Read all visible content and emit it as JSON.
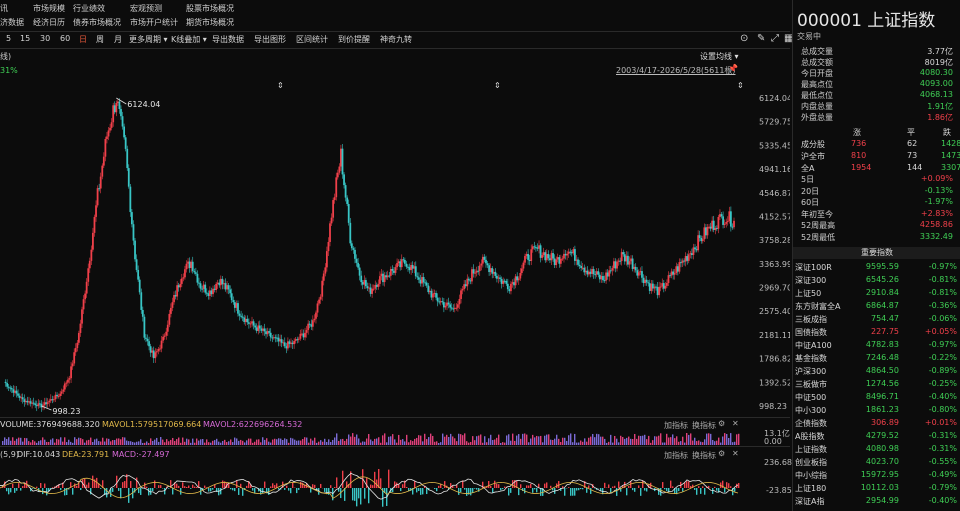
{
  "menu": {
    "row1": [
      "讯",
      "市场规模",
      "行业绩效",
      "宏观预测",
      "股票市场概况"
    ],
    "row2": [
      "济数据",
      "经济日历",
      "债券市场概况",
      "市场开户统计",
      "期货市场概况"
    ]
  },
  "toolbar": {
    "items": [
      "5",
      "15",
      "30",
      "60",
      "日",
      "周",
      "月",
      "更多周期 ▾",
      "K线叠加 ▾",
      "导出数据",
      "导出图形",
      "区间统计",
      "到价提醒",
      "神奇九转"
    ],
    "active": "日",
    "right_icons": [
      "circle-chevron",
      "pen",
      "expand",
      "grid"
    ]
  },
  "chart_header": {
    "left_label": "线)",
    "percent": "31%",
    "settings": "设置均线 ▾",
    "range": "2003/4/17-2026/5/28(5611根)"
  },
  "chart_data": {
    "type": "line",
    "title": "",
    "ylabels": [
      "6124.04",
      "5729.75",
      "5335.45",
      "4941.16",
      "4546.87",
      "4152.57",
      "3758.28",
      "3363.99",
      "2969.70",
      "2575.40",
      "2181.11",
      "1786.82",
      "1392.52",
      "998.23"
    ],
    "ylim": [
      998.23,
      6124.04
    ],
    "x_start": "2003/4/17",
    "x_end": "2026/5/28",
    "annotations": [
      {
        "label": "6124.04"
      },
      {
        "label": "998.23"
      }
    ],
    "series": [
      {
        "values": [
          1400,
          1250,
          1100,
          1050,
          998,
          1100,
          1200,
          1500,
          2200,
          3300,
          4500,
          5500,
          6124,
          5200,
          3500,
          2200,
          1800,
          2100,
          2700,
          3200,
          3400,
          3000,
          2900,
          3100,
          2900,
          2600,
          2400,
          2300,
          2200,
          2100,
          2000,
          2050,
          2200,
          2400,
          3000,
          4200,
          5178,
          3800,
          3200,
          2900,
          3100,
          3200,
          3300,
          3400,
          3200,
          3000,
          2800,
          2700,
          2600,
          2900,
          3200,
          3400,
          3300,
          3100,
          3000,
          3200,
          3500,
          3600,
          3500,
          3400,
          3600,
          3500,
          3300,
          3200,
          3100,
          3300,
          3500,
          3400,
          3200,
          3000,
          2900,
          3100,
          3300,
          3500,
          3700,
          3900,
          4050,
          4150,
          4080
        ]
      }
    ]
  },
  "volume": {
    "label": "VOLUME:376949688.320",
    "mavol1": "MAVOL1:579517069.664",
    "mavol2": "MAVOL2:622696264.532",
    "tick_top": "13.1亿",
    "tick_bottom": "0.00",
    "add_indicator": "加指标",
    "switch_indicator": "换指标"
  },
  "macd": {
    "params": "(5,9)",
    "dif": "DIF:10.043",
    "dea": "DEA:23.791",
    "macd": "MACD:-27.497",
    "tick_top": "236.68",
    "tick_mid": "-23.85",
    "add_indicator": "加指标",
    "switch_indicator": "换指标"
  },
  "stock": {
    "code_name": "000001 上证指数",
    "status": "交易中",
    "stats": [
      {
        "k": "总成交量",
        "v": "3.77亿",
        "c": "white"
      },
      {
        "k": "总成交额",
        "v": "8019亿",
        "c": "white"
      },
      {
        "k": "今日开盘",
        "v": "4080.30",
        "c": "green"
      },
      {
        "k": "最高点位",
        "v": "4093.00",
        "c": "green"
      },
      {
        "k": "最低点位",
        "v": "4068.13",
        "c": "green"
      },
      {
        "k": "内盘总量",
        "v": "1.91亿",
        "c": "green"
      },
      {
        "k": "外盘总量",
        "v": "1.86亿",
        "c": "red"
      }
    ],
    "breadth_header": [
      "涨",
      "平",
      "跌"
    ],
    "breadth": [
      {
        "k": "成分股",
        "up": "736",
        "flat": "62",
        "down": "1428"
      },
      {
        "k": "沪全市",
        "up": "810",
        "flat": "73",
        "down": "1473"
      },
      {
        "k": "全A",
        "up": "1954",
        "flat": "144",
        "down": "3307"
      }
    ],
    "periods": [
      {
        "k": "5日",
        "v": "+0.09%",
        "c": "red"
      },
      {
        "k": "20日",
        "v": "-0.13%",
        "c": "green"
      },
      {
        "k": "60日",
        "v": "-1.97%",
        "c": "green"
      },
      {
        "k": "年初至今",
        "v": "+2.83%",
        "c": "red"
      },
      {
        "k": "52周最高",
        "v": "4258.86",
        "c": "red"
      },
      {
        "k": "52周最低",
        "v": "3332.49",
        "c": "green"
      }
    ],
    "index_title": "重要指数",
    "indices": [
      {
        "n": "深证100R",
        "p": "9595.59",
        "c": "-0.97%",
        "col": "green"
      },
      {
        "n": "深证300",
        "p": "6545.26",
        "c": "-0.81%",
        "col": "green"
      },
      {
        "n": "上证50",
        "p": "2910.84",
        "c": "-0.81%",
        "col": "green"
      },
      {
        "n": "东方财富全A",
        "p": "6864.87",
        "c": "-0.36%",
        "col": "green"
      },
      {
        "n": "三板成指",
        "p": "754.47",
        "c": "-0.06%",
        "col": "green"
      },
      {
        "n": "国债指数",
        "p": "227.75",
        "c": "+0.05%",
        "col": "red"
      },
      {
        "n": "中证A100",
        "p": "4782.83",
        "c": "-0.97%",
        "col": "green"
      },
      {
        "n": "基金指数",
        "p": "7246.48",
        "c": "-0.22%",
        "col": "green"
      },
      {
        "n": "沪深300",
        "p": "4864.50",
        "c": "-0.89%",
        "col": "green"
      },
      {
        "n": "三板做市",
        "p": "1274.56",
        "c": "-0.25%",
        "col": "green"
      },
      {
        "n": "中证500",
        "p": "8496.71",
        "c": "-0.40%",
        "col": "green"
      },
      {
        "n": "中小300",
        "p": "1861.23",
        "c": "-0.80%",
        "col": "green"
      },
      {
        "n": "企债指数",
        "p": "306.89",
        "c": "+0.01%",
        "col": "red"
      },
      {
        "n": "A股指数",
        "p": "4279.52",
        "c": "-0.31%",
        "col": "green"
      },
      {
        "n": "上证指数",
        "p": "4080.98",
        "c": "-0.31%",
        "col": "green"
      },
      {
        "n": "创业板指",
        "p": "4023.70",
        "c": "-0.55%",
        "col": "green"
      },
      {
        "n": "中小综指",
        "p": "15972.95",
        "c": "-0.49%",
        "col": "green"
      },
      {
        "n": "上证180",
        "p": "10112.03",
        "c": "-0.79%",
        "col": "green"
      },
      {
        "n": "深证A指",
        "p": "2954.99",
        "c": "-0.40%",
        "col": "green"
      }
    ]
  }
}
